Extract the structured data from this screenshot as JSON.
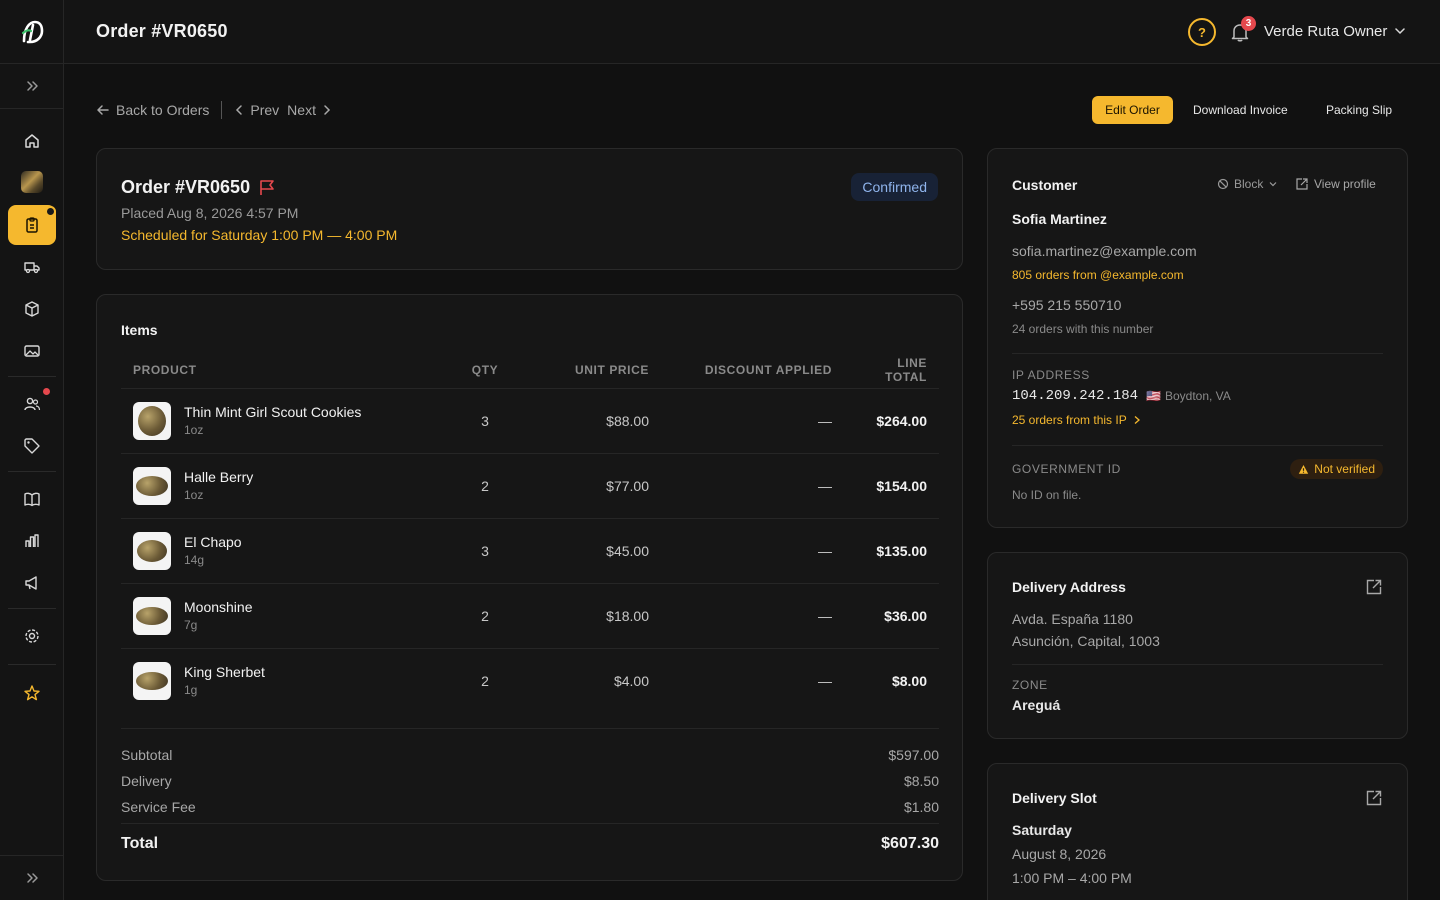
{
  "header": {
    "title": "Order #VR0650",
    "notification_count": "3",
    "user_label": "Verde Ruta Owner"
  },
  "nav": {
    "back_label": "Back to Orders",
    "prev_label": "Prev",
    "next_label": "Next"
  },
  "actions": {
    "edit_label": "Edit Order",
    "invoice_label": "Download Invoice",
    "packing_label": "Packing Slip"
  },
  "order": {
    "title": "Order #VR0650",
    "placed": "Placed Aug 8, 2026 4:57 PM",
    "scheduled": "Scheduled for Saturday 1:00 PM — 4:00 PM",
    "status": "Confirmed"
  },
  "items": {
    "heading": "Items",
    "columns": [
      "PRODUCT",
      "QTY",
      "UNIT PRICE",
      "DISCOUNT APPLIED",
      "LINE TOTAL"
    ],
    "rows": [
      {
        "name": "Thin Mint Girl Scout Cookies",
        "size": "1oz",
        "qty": "3",
        "unit": "$88.00",
        "discount": "—",
        "total": "$264.00"
      },
      {
        "name": "Halle Berry",
        "size": "1oz",
        "qty": "2",
        "unit": "$77.00",
        "discount": "—",
        "total": "$154.00"
      },
      {
        "name": "El Chapo",
        "size": "14g",
        "qty": "3",
        "unit": "$45.00",
        "discount": "—",
        "total": "$135.00"
      },
      {
        "name": "Moonshine",
        "size": "7g",
        "qty": "2",
        "unit": "$18.00",
        "discount": "—",
        "total": "$36.00"
      },
      {
        "name": "King Sherbet",
        "size": "1g",
        "qty": "2",
        "unit": "$4.00",
        "discount": "—",
        "total": "$8.00"
      }
    ]
  },
  "totals": {
    "subtotal_label": "Subtotal",
    "subtotal": "$597.00",
    "delivery_label": "Delivery",
    "delivery": "$8.50",
    "fee_label": "Service Fee",
    "fee": "$1.80",
    "total_label": "Total",
    "total": "$607.30"
  },
  "customer": {
    "heading": "Customer",
    "block_label": "Block",
    "view_label": "View profile",
    "name": "Sofia Martinez",
    "email": "sofia.martinez@example.com",
    "email_orders": "805 orders from @example.com",
    "phone": "+595 215 550710",
    "phone_orders": "24 orders with this number",
    "ip_label": "IP ADDRESS",
    "ip": "104.209.242.184",
    "ip_flag": "🇺🇸",
    "ip_location": "Boydton, VA",
    "ip_orders": "25 orders from this IP",
    "gov_label": "GOVERNMENT ID",
    "gov_status": "Not verified",
    "gov_note": "No ID on file."
  },
  "address": {
    "heading": "Delivery Address",
    "line1": "Avda. España 1180",
    "line2": "Asunción, Capital, 1003",
    "zone_label": "ZONE",
    "zone": "Areguá"
  },
  "slot": {
    "heading": "Delivery Slot",
    "day": "Saturday",
    "date": "August 8, 2026",
    "time": "1:00 PM – 4:00 PM"
  },
  "colors": {
    "accent": "#f5b82e",
    "background": "#111111",
    "card": "#161616",
    "danger": "#e5484d",
    "confirmed_bg": "#182236",
    "confirmed_text": "#8fb4ec"
  }
}
